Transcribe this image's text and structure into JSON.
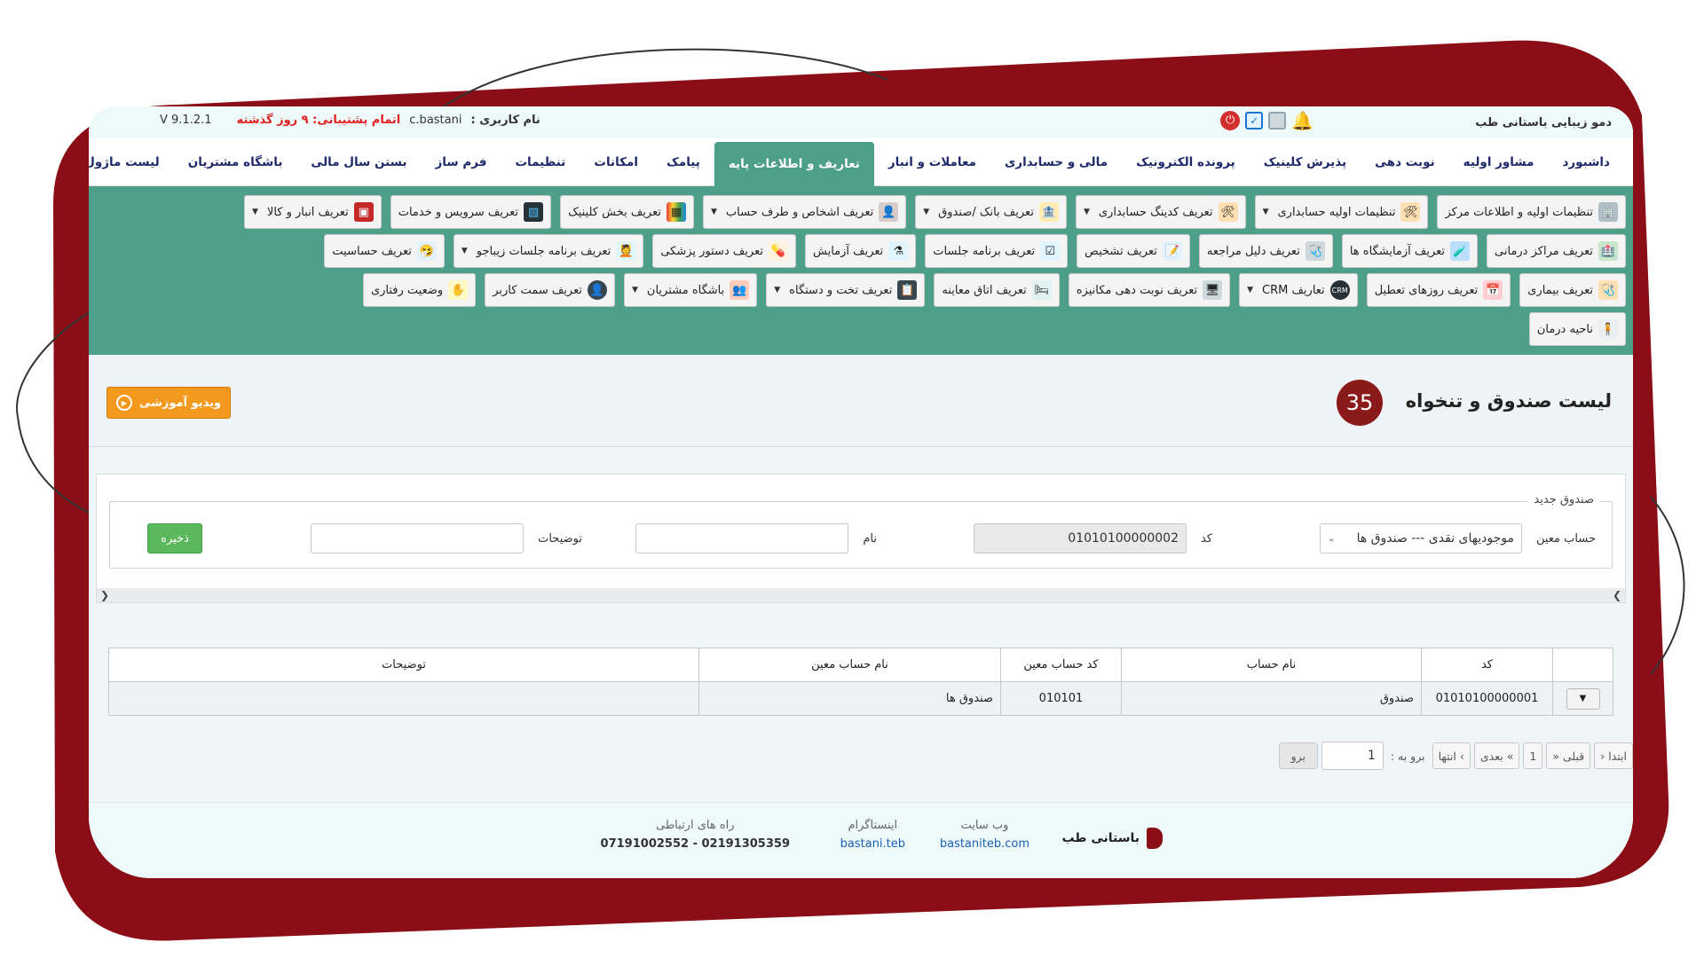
{
  "topbar": {
    "company": "دمو زیبایی باستانی طب",
    "user_label": "نام کاربری :",
    "username": "c.bastani",
    "support_warning": "اتمام پشتیبانی: ۹ روز گذشته",
    "version": "V 9.1.2.1"
  },
  "main_nav": [
    {
      "label": "داشبورد"
    },
    {
      "label": "مشاور اولیه"
    },
    {
      "label": "نوبت دهی"
    },
    {
      "label": "پذیرش کلینیک"
    },
    {
      "label": "پرونده الکترونیک"
    },
    {
      "label": "مالی و حسابداری"
    },
    {
      "label": "معاملات و انبار"
    },
    {
      "label": "تعاریف و اطلاعات پایه"
    },
    {
      "label": "پیامک"
    },
    {
      "label": "امکانات"
    },
    {
      "label": "تنظیمات"
    },
    {
      "label": "فرم ساز"
    },
    {
      "label": "بستن سال مالی"
    },
    {
      "label": "باشگاه مشتریان"
    },
    {
      "label": "لیست ماژول ها"
    }
  ],
  "sub_nav": {
    "row1": [
      {
        "label": "تنظیمات اولیه و اطلاعات مرکز",
        "icon": "building-icon",
        "dd": false
      },
      {
        "label": "تنظیمات اولیه حسابداری",
        "icon": "tools-icon",
        "dd": true
      },
      {
        "label": "تعریف کدینگ حسابداری",
        "icon": "tools-icon",
        "dd": true
      },
      {
        "label": "تعریف بانک /صندوق",
        "icon": "bank-icon",
        "dd": true
      },
      {
        "label": "تعریف اشخاص و طرف حساب",
        "icon": "person-icon",
        "dd": true
      },
      {
        "label": "تعریف بخش کلینیک",
        "icon": "grid-icon",
        "dd": false
      },
      {
        "label": "تعریف سرویس و خدمات",
        "icon": "chart-icon",
        "dd": false
      },
      {
        "label": "تعریف انبار و کالا",
        "icon": "warehouse-icon",
        "dd": true
      }
    ],
    "row2": [
      {
        "label": "تعریف مراکز درمانی",
        "icon": "hospital-icon"
      },
      {
        "label": "تعریف آزمایشگاه ها",
        "icon": "lab-icon"
      },
      {
        "label": "تعریف دلیل مراجعه",
        "icon": "doctor-icon"
      },
      {
        "label": "تعریف تشخیص",
        "icon": "diagnosis-icon"
      },
      {
        "label": "تعریف برنامه جلسات",
        "icon": "checklist-icon"
      },
      {
        "label": "تعریف آزمایش",
        "icon": "flask-icon"
      },
      {
        "label": "تعریف دستور پزشکی",
        "icon": "prescription-icon"
      },
      {
        "label": "تعریف برنامه جلسات زیباجو",
        "icon": "beauty-icon",
        "dd": true
      },
      {
        "label": "تعریف حساسیت",
        "icon": "allergy-icon"
      }
    ],
    "row3": [
      {
        "label": "تعریف بیماری",
        "icon": "patient-icon"
      },
      {
        "label": "تعریف روزهای تعطیل",
        "icon": "calendar-icon"
      },
      {
        "label": "تعاریف CRM",
        "icon": "crm-icon",
        "dd": true
      },
      {
        "label": "تعریف نوبت دهی مکانیزه",
        "icon": "monitor-icon"
      },
      {
        "label": "تعریف اتاق معاینه",
        "icon": "room-icon"
      },
      {
        "label": "تعریف تخت و دستگاه",
        "icon": "clipboard-icon",
        "dd": true
      },
      {
        "label": "باشگاه مشتریان",
        "icon": "group-icon",
        "dd": true
      },
      {
        "label": "تعریف سمت کاربر",
        "icon": "user-role-icon"
      },
      {
        "label": "وضعیت رفتاری",
        "icon": "behavior-icon"
      }
    ],
    "row4": [
      {
        "label": "ناحیه درمان",
        "icon": "body-icon"
      }
    ]
  },
  "page": {
    "title": "لیست صندوق و تنخواه",
    "badge": "35",
    "video_button": "ویدیو آموزشی"
  },
  "form": {
    "legend": "صندوق جدید",
    "account_label": "حساب معین",
    "account_value": "موجودیهای نقدی --- صندوق ها",
    "code_label": "کد",
    "code_value": "01010100000002",
    "name_label": "نام",
    "name_value": "",
    "desc_label": "توضیحات",
    "desc_value": "",
    "save_label": "ذخیره"
  },
  "table": {
    "headers": [
      "کد",
      "نام حساب",
      "کد حساب معین",
      "نام حساب معین",
      "توضیحات"
    ],
    "rows": [
      {
        "code": "01010100000001",
        "account_name": "صندوق",
        "ledger_code": "010101",
        "ledger_name": "صندوق ها",
        "desc": ""
      }
    ]
  },
  "pager": {
    "first": "ابتدا",
    "prev": "قبلی",
    "page": "1",
    "next": "بعدی",
    "last": "انتها",
    "goto_label": "برو به :",
    "goto_value": "1",
    "go_button": "برو"
  },
  "footer": {
    "brand": "باستانی طب",
    "website_label": "وب سایت",
    "website_value": "bastaniteb.com",
    "instagram_label": "اینستاگرام",
    "instagram_value": "bastani.teb",
    "contact_label": "راه های ارتباطی",
    "contact_value": "07191002552 - 02191305359"
  },
  "colors": {
    "frame": "#8b0e16",
    "nav_green": "#4e9f8a",
    "orange": "#f39a1e",
    "save_green": "#5cb85c"
  }
}
